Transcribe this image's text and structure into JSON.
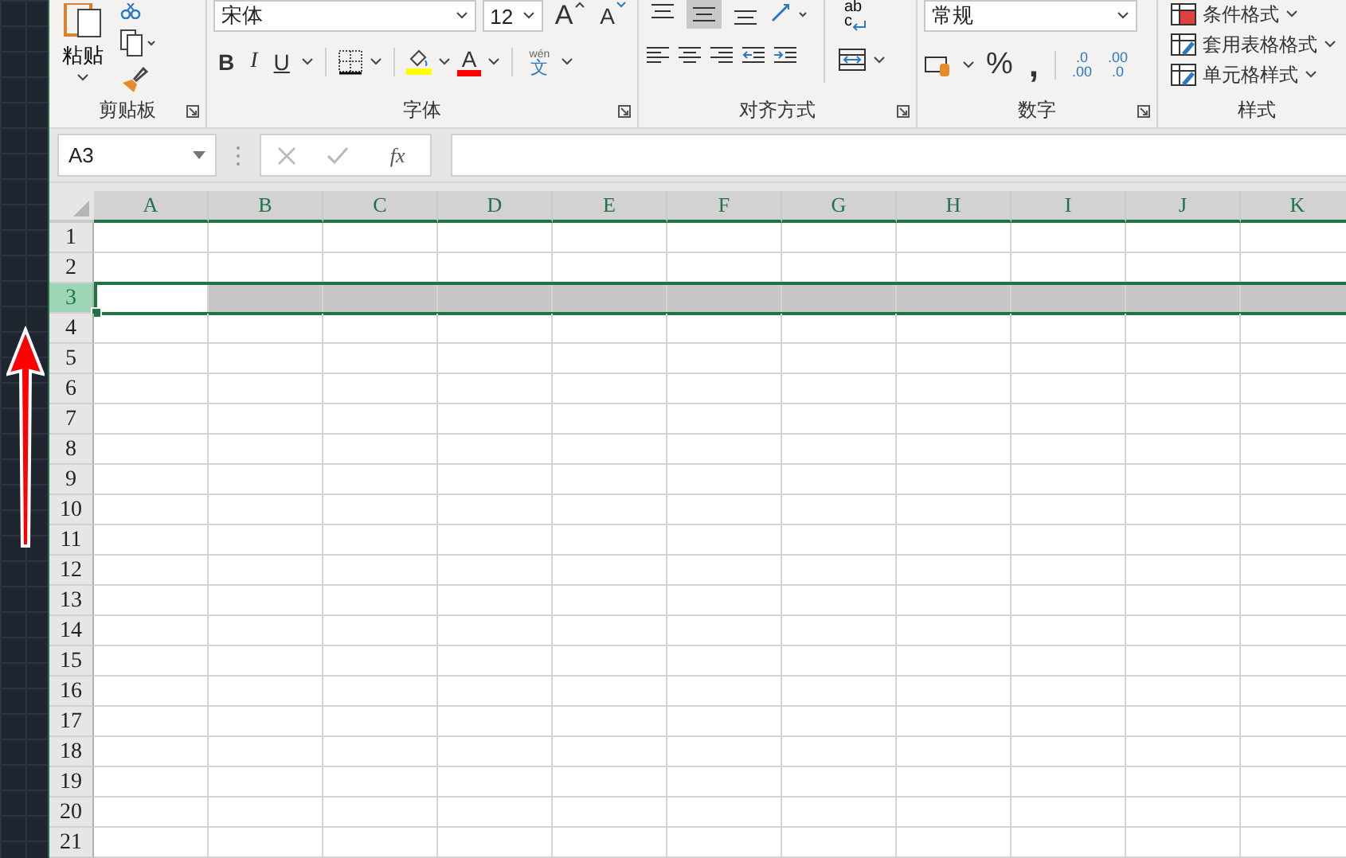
{
  "ribbon": {
    "clipboard": {
      "paste": "粘贴",
      "label": "剪贴板"
    },
    "font": {
      "name": "宋体",
      "size": "12",
      "grow": "A",
      "shrink": "A",
      "bold": "B",
      "italic": "I",
      "underline": "U",
      "color_letter": "A",
      "phonetic_top": "wén",
      "phonetic_char": "文",
      "label": "字体"
    },
    "alignment": {
      "vertical": [
        {
          "selected": false
        },
        {
          "selected": true
        },
        {
          "selected": false
        }
      ],
      "wrap_top": "ab",
      "wrap_bottom": "c",
      "label": "对齐方式"
    },
    "number": {
      "format": "常规",
      "percent": "%",
      "comma": ",",
      "inc_top": ".0",
      "inc_bottom": ".00",
      "dec_top": ".00",
      "dec_bottom": ".0",
      "label": "数字"
    },
    "styles": {
      "items": [
        "条件格式",
        "套用表格格式",
        "单元格样式"
      ],
      "label": "样式"
    }
  },
  "formula_bar": {
    "name_box": "A3",
    "fx": "fx"
  },
  "sheet": {
    "columns": [
      "A",
      "B",
      "C",
      "D",
      "E",
      "F",
      "G",
      "H",
      "I",
      "J",
      "K"
    ],
    "rows": [
      {
        "label": "1",
        "selected": false
      },
      {
        "label": "2",
        "selected": false
      },
      {
        "label": "3",
        "selected": true
      },
      {
        "label": "4",
        "selected": false
      },
      {
        "label": "5",
        "selected": false
      },
      {
        "label": "6",
        "selected": false
      },
      {
        "label": "7",
        "selected": false
      },
      {
        "label": "8",
        "selected": false
      },
      {
        "label": "9",
        "selected": false
      },
      {
        "label": "10",
        "selected": false
      },
      {
        "label": "11",
        "selected": false
      },
      {
        "label": "12",
        "selected": false
      },
      {
        "label": "13",
        "selected": false
      },
      {
        "label": "14",
        "selected": false
      },
      {
        "label": "15",
        "selected": false
      },
      {
        "label": "16",
        "selected": false
      },
      {
        "label": "17",
        "selected": false
      },
      {
        "label": "18",
        "selected": false
      },
      {
        "label": "19",
        "selected": false
      },
      {
        "label": "20",
        "selected": false
      },
      {
        "label": "21",
        "selected": false
      }
    ]
  }
}
